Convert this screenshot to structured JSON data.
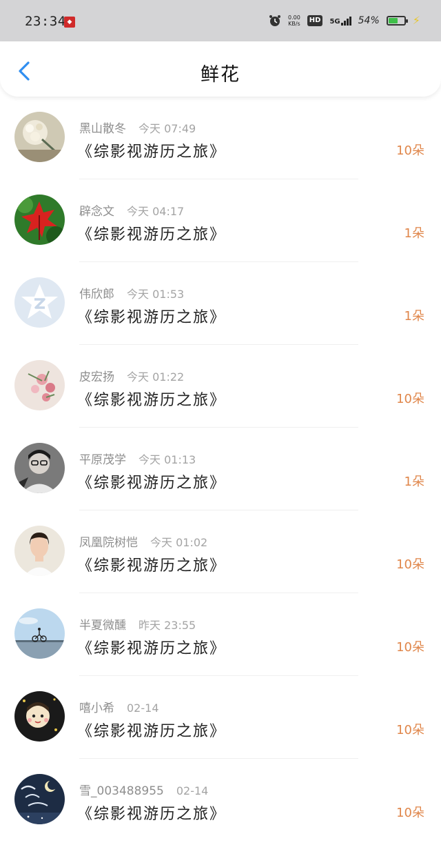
{
  "status_bar": {
    "time": "23:34",
    "net_speed_value": "0.00",
    "net_speed_unit": "KB/s",
    "hd": "HD",
    "network": "5G",
    "battery_percent": "54%",
    "battery_level": 0.54
  },
  "header": {
    "title": "鲜花"
  },
  "colors": {
    "count_orange": "#e0864a",
    "back_blue": "#2f8ef0"
  },
  "items": [
    {
      "name": "黑山散冬",
      "time": "今天 07:49",
      "book": "《综影视游历之旅》",
      "count": "10朵",
      "avatar": "dried-flowers-photo"
    },
    {
      "name": "辟念文",
      "time": "今天 04:17",
      "book": "《综影视游历之旅》",
      "count": "1朵",
      "avatar": "red-maple-leaf-photo"
    },
    {
      "name": "伟欣郎",
      "time": "今天 01:53",
      "book": "《综影视游历之旅》",
      "count": "1朵",
      "avatar": "default-star-avatar"
    },
    {
      "name": "皮宏扬",
      "time": "今天 01:22",
      "book": "《综影视游历之旅》",
      "count": "10朵",
      "avatar": "pink-flowers-photo"
    },
    {
      "name": "平原茂学",
      "time": "今天 01:13",
      "book": "《综影视游历之旅》",
      "count": "1朵",
      "avatar": "person-with-glasses-photo"
    },
    {
      "name": "凤凰院树恺",
      "time": "今天 01:02",
      "book": "《综影视游历之旅》",
      "count": "10朵",
      "avatar": "woman-portrait-photo"
    },
    {
      "name": "半夏微醺",
      "time": "昨天 23:55",
      "book": "《综影视游历之旅》",
      "count": "10朵",
      "avatar": "cyclist-sky-photo"
    },
    {
      "name": "嘻小希",
      "time": "02-14",
      "book": "《综影视游历之旅》",
      "count": "10朵",
      "avatar": "cartoon-avatar"
    },
    {
      "name": "雪_003488955",
      "time": "02-14",
      "book": "《综影视游历之旅》",
      "count": "10朵",
      "avatar": "moonlight-lover-avatar"
    }
  ]
}
